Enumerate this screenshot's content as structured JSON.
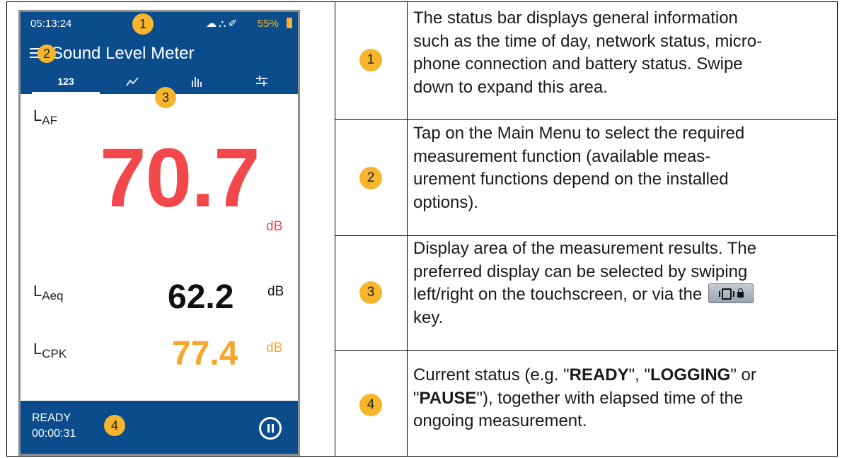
{
  "phone": {
    "status_bar": {
      "time": "05:13:24",
      "icons": [
        "cloud-icon",
        "network-icon",
        "microphone-icon"
      ],
      "battery": "55%"
    },
    "app_title": "Sound Level Meter",
    "tabs": [
      {
        "label": "123",
        "active": true
      },
      {
        "icon": "line-chart-icon"
      },
      {
        "icon": "bar-spectrum-icon"
      },
      {
        "icon": "settings-sliders-icon"
      }
    ],
    "main_label": {
      "base": "L",
      "sub": "AF"
    },
    "main_value": "70.7",
    "main_unit": "dB",
    "row2": {
      "base": "L",
      "sub": "Aeq",
      "value": "62.2",
      "unit": "dB"
    },
    "row3": {
      "base": "L",
      "sub": "CPK",
      "value": "77.4",
      "unit": "dB"
    },
    "status": "READY",
    "elapsed": "00:00:31",
    "callouts": [
      "1",
      "2",
      "3",
      "4"
    ]
  },
  "rows": [
    {
      "number": "1",
      "lines": [
        "The status bar displays general information",
        "such as the time of day, network status, micro-",
        "phone connection and battery status. Swipe",
        "down to expand this area."
      ]
    },
    {
      "number": "2",
      "lines": [
        "Tap on the Main Menu to select the required",
        "measurement function (available meas-",
        "urement functions depend on the installed",
        "options)."
      ]
    },
    {
      "number": "3",
      "lines": [
        "Display area of the measurement results. The",
        "preferred display can be selected by swiping",
        "left/right on the touchscreen, or via the",
        "key."
      ]
    },
    {
      "number": "4",
      "line1_pre": "Current status (e.g. \"",
      "ready": "READY",
      "line1_mid": "\", \"",
      "logging": "LOGGING",
      "line1_post": "\" or",
      "line2_pre": "\"",
      "pause": "PAUSE",
      "line2_post": "\"), together with elapsed time of the",
      "line3": "ongoing measurement."
    }
  ],
  "colors": {
    "bar_blue": "#0b4c8c",
    "red_value": "#f2484c",
    "orange_value": "#f7a72c",
    "badge": "#f7b52c"
  }
}
